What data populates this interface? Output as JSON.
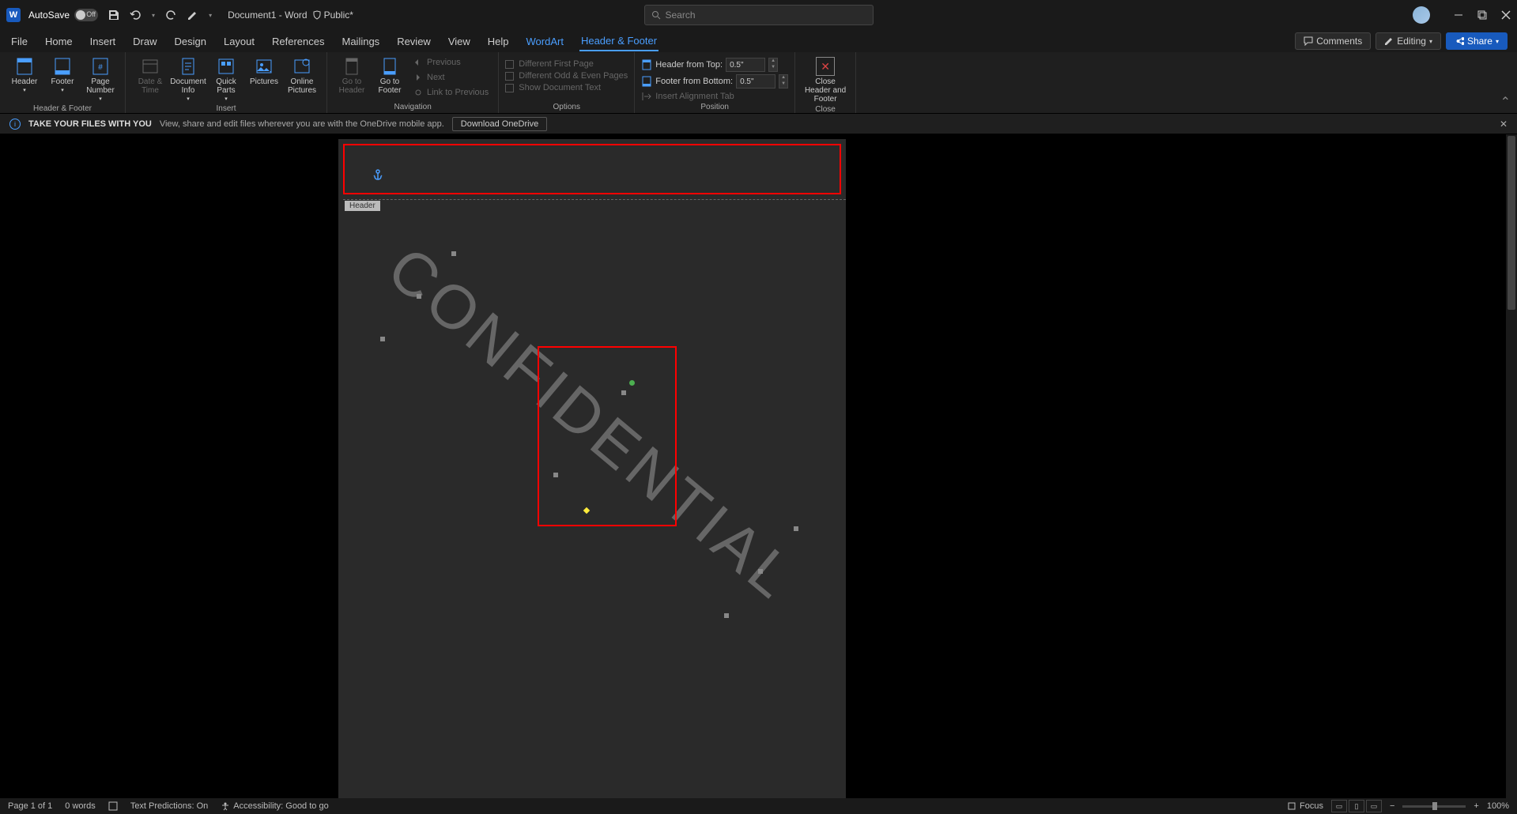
{
  "titlebar": {
    "autosave_label": "AutoSave",
    "autosave_state": "Off",
    "doc_title": "Document1 - Word",
    "sensitivity": "Public*",
    "search_placeholder": "Search"
  },
  "tabs": {
    "items": [
      "File",
      "Home",
      "Insert",
      "Draw",
      "Design",
      "Layout",
      "References",
      "Mailings",
      "Review",
      "View",
      "Help"
    ],
    "context": [
      "WordArt",
      "Header & Footer"
    ],
    "active": "Header & Footer",
    "comments": "Comments",
    "editing": "Editing",
    "share": "Share"
  },
  "ribbon": {
    "hf": {
      "header": "Header",
      "footer": "Footer",
      "page_number": "Page Number",
      "label": "Header & Footer"
    },
    "insert": {
      "date_time": "Date & Time",
      "doc_info": "Document Info",
      "quick_parts": "Quick Parts",
      "pictures": "Pictures",
      "online_pictures": "Online Pictures",
      "label": "Insert"
    },
    "nav": {
      "goto_header": "Go to Header",
      "goto_footer": "Go to Footer",
      "previous": "Previous",
      "next": "Next",
      "link": "Link to Previous",
      "label": "Navigation"
    },
    "options": {
      "diff_first": "Different First Page",
      "diff_odd_even": "Different Odd & Even Pages",
      "show_doc": "Show Document Text",
      "label": "Options"
    },
    "position": {
      "header_top": "Header from Top:",
      "header_top_val": "0.5\"",
      "footer_bottom": "Footer from Bottom:",
      "footer_bottom_val": "0.5\"",
      "align_tab": "Insert Alignment Tab",
      "label": "Position"
    },
    "close": {
      "btn": "Close Header and Footer",
      "label": "Close"
    }
  },
  "infobar": {
    "title": "TAKE YOUR FILES WITH YOU",
    "text": "View, share and edit files wherever you are with the OneDrive mobile app.",
    "download": "Download OneDrive"
  },
  "page": {
    "header_label": "Header",
    "watermark_text": "CONFIDENTIAL"
  },
  "statusbar": {
    "page": "Page 1 of 1",
    "words": "0 words",
    "predictions": "Text Predictions: On",
    "accessibility": "Accessibility: Good to go",
    "focus": "Focus",
    "zoom": "100%"
  }
}
